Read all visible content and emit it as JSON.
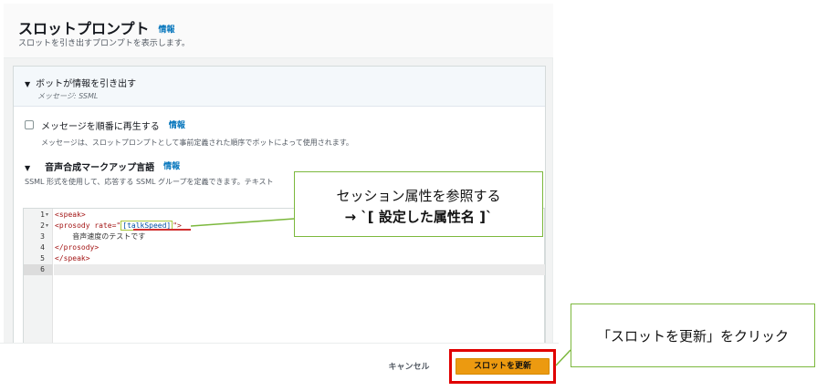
{
  "header": {
    "title": "スロットプロンプト",
    "info": "情報",
    "subtitle": "スロットを引き出すプロンプトを表示します。"
  },
  "accordion": {
    "title": "ボットが情報を引き出す",
    "subtitle": "メッセージ: SSML"
  },
  "checkbox": {
    "label": "メッセージを順番に再生する",
    "info": "情報",
    "checked": false,
    "description": "メッセージは、スロットプロンプトとして事前定義された順序でボットによって使用されます。"
  },
  "ssml": {
    "title": "音声合成マークアップ言語",
    "info": "情報",
    "description": "SSML 形式を使用して、応答する SSML グループを定義できます。テキスト"
  },
  "editor": {
    "line_numbers": [
      "1",
      "2",
      "3",
      "4",
      "5",
      "6"
    ],
    "fold_markers": [
      "▾",
      "▾"
    ],
    "lines": {
      "l1": "<speak>",
      "l2_open": "<prosody rate=\"",
      "l2_value": "[talkSpeed]",
      "l2_close": "\">",
      "l3": "    音声速度のテストです",
      "l4": "</prosody>",
      "l5": "</speak>"
    }
  },
  "footer": {
    "cancel_label": "キャンセル",
    "update_label": "スロットを更新"
  },
  "callouts": {
    "attr_line1": "セッション属性を参照する",
    "attr_line2": "→ `[ 設定した属性名 ]`",
    "click_text": "「スロットを更新」をクリック"
  },
  "colors": {
    "accent_orange": "#ec9a10",
    "link_blue": "#0073bb",
    "callout_green": "#7cb83d",
    "highlight_red": "#e00000"
  }
}
